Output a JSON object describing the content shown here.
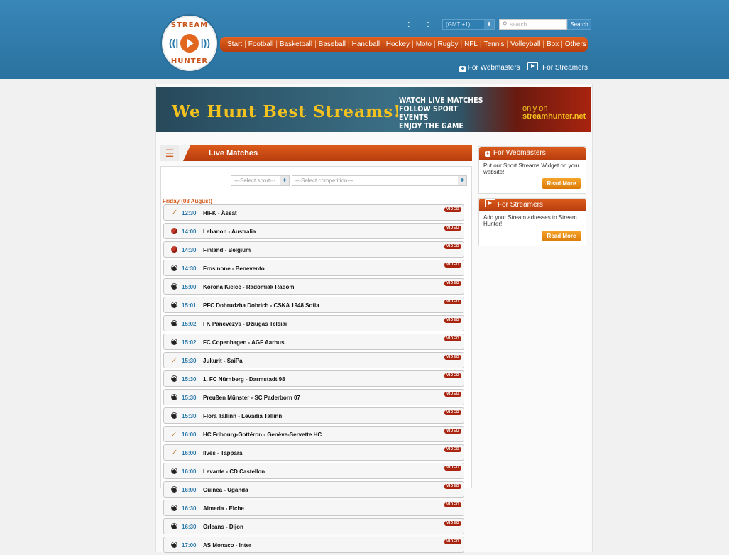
{
  "logo": {
    "top_text": "STREAM",
    "bottom_text": "HUNTER"
  },
  "header": {
    "colons": ": :",
    "timezone": {
      "selected": "(GMT +1)"
    },
    "search": {
      "placeholder": "search...",
      "button_label": "Search"
    },
    "nav": [
      "Start",
      "Football",
      "Basketball",
      "Baseball",
      "Handball",
      "Hockey",
      "Moto",
      "Rugby",
      "NFL",
      "Tennis",
      "Volleyball",
      "Box",
      "Others"
    ],
    "links": {
      "webmasters": "For Webmasters",
      "streamers": "For Streamers"
    }
  },
  "banner": {
    "headline": "We Hunt Best Streams!",
    "line1": "WATCH LIVE MATCHES",
    "line2": "FOLLOW SPORT EVENTS",
    "line3": "ENJOY THE GAME",
    "only_on": "only on",
    "site": "streamhunter.net",
    "colors": {
      "headline": "#f4c21e",
      "accent": "#a8230f"
    }
  },
  "live_matches": {
    "title": "Live Matches",
    "select_sport": "---Select sport---",
    "select_competition": "---Select competition---",
    "date_heading": "Friday (08 August)",
    "video_label": "VIDEO",
    "matches": [
      {
        "sport": "hockey",
        "time": "12:30",
        "teams": "HIFK - Ässät"
      },
      {
        "sport": "basketball",
        "time": "14:00",
        "teams": "Lebanon - Australia"
      },
      {
        "sport": "basketball",
        "time": "14:30",
        "teams": "Finland - Belgium"
      },
      {
        "sport": "football",
        "time": "14:30",
        "teams": "Frosinone - Benevento"
      },
      {
        "sport": "football",
        "time": "15:00",
        "teams": "Korona Kielce - Radomiak Radom"
      },
      {
        "sport": "football",
        "time": "15:01",
        "teams": "PFC Dobrudzha Dobrich - CSKA 1948 Sofia"
      },
      {
        "sport": "football",
        "time": "15:02",
        "teams": "FK Panevezys - Džiugas Telšiai"
      },
      {
        "sport": "football",
        "time": "15:02",
        "teams": "FC Copenhagen - AGF Aarhus"
      },
      {
        "sport": "hockey",
        "time": "15:30",
        "teams": "Jukurit - SaiPa"
      },
      {
        "sport": "football",
        "time": "15:30",
        "teams": "1. FC Nürnberg - Darmstadt 98"
      },
      {
        "sport": "football",
        "time": "15:30",
        "teams": "Preußen Münster - SC Paderborn 07"
      },
      {
        "sport": "football",
        "time": "15:30",
        "teams": "Flora Tallinn - Levadia Tallinn"
      },
      {
        "sport": "hockey",
        "time": "16:00",
        "teams": "HC Fribourg-Gottéron - Genève-Servette HC"
      },
      {
        "sport": "hockey",
        "time": "16:00",
        "teams": "Ilves - Tappara"
      },
      {
        "sport": "football",
        "time": "16:00",
        "teams": "Levante - CD Castellon"
      },
      {
        "sport": "football",
        "time": "16:00",
        "teams": "Guinea - Uganda"
      },
      {
        "sport": "football",
        "time": "16:30",
        "teams": "Almeria - Elche"
      },
      {
        "sport": "football",
        "time": "16:30",
        "teams": "Orleans - Dijon"
      },
      {
        "sport": "football",
        "time": "17:00",
        "teams": "AS Monaco - Inter"
      }
    ]
  },
  "sidebar": {
    "webmasters": {
      "title": "For Webmasters",
      "text": "Put our Sport Streams Widget on your website!",
      "button": "Read More"
    },
    "streamers": {
      "title": "For Streamers",
      "text": "Add your Stream adresses to Stream Hunter!",
      "button": "Read More"
    }
  }
}
